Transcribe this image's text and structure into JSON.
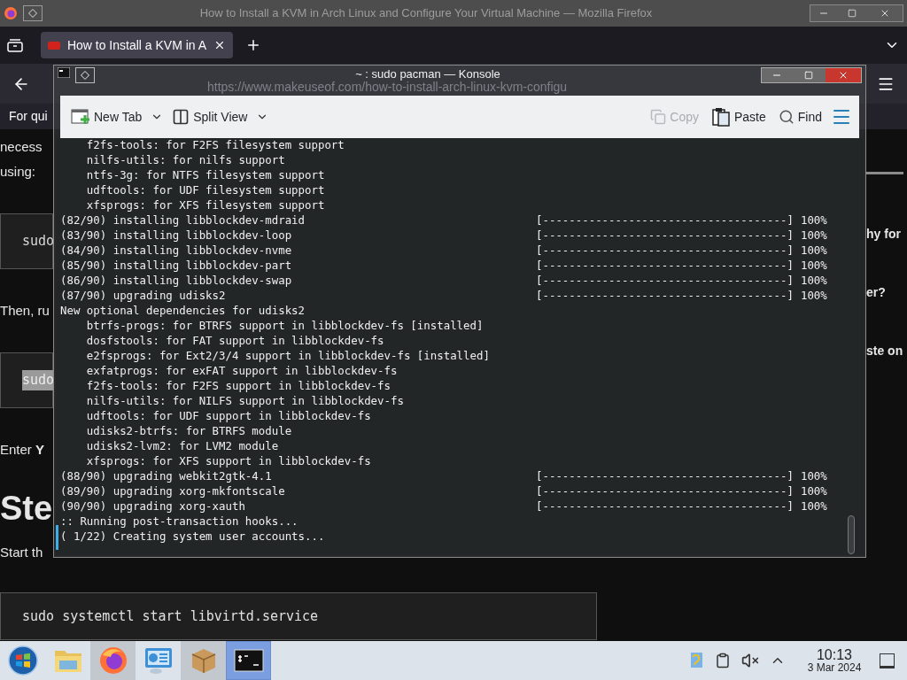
{
  "firefox": {
    "title": "How to Install a KVM in Arch Linux and Configure Your Virtual Machine — Mozilla Firefox",
    "tabs": [
      {
        "title": "How to Install a KVM in A",
        "selected": true
      }
    ],
    "url": "https://www.makeuseof.com/how-to-install-arch-linux-kvm-configu",
    "banner": "For qui",
    "article_left": [
      {
        "kind": "text",
        "text": "necess"
      },
      {
        "kind": "text",
        "text": "using:"
      },
      {
        "kind": "code",
        "text": "sudo",
        "selected": false
      },
      {
        "kind": "text",
        "text": "Then, ru"
      },
      {
        "kind": "code",
        "text": "sudo",
        "selected": true
      },
      {
        "kind": "text",
        "text": "Enter **Y**"
      },
      {
        "kind": "heading",
        "text": "Ste"
      },
      {
        "kind": "text",
        "text": "Start th"
      }
    ],
    "article_right": [
      {
        "kind": "rule"
      },
      {
        "kind": "text",
        "text": "hy for"
      },
      {
        "kind": "text",
        "text": "er?"
      },
      {
        "kind": "text",
        "text": "ste on"
      }
    ],
    "code_block": "sudo systemctl start libvirtd.service"
  },
  "konsole": {
    "title": "~ : sudo pacman — Konsole",
    "toolbar": [
      {
        "kind": "new-tab",
        "label": "New Tab",
        "disabled": false
      },
      {
        "kind": "split-view",
        "label": "Split View",
        "disabled": false
      },
      {
        "kind": "copy",
        "label": "Copy",
        "disabled": true
      },
      {
        "kind": "paste",
        "label": "Paste",
        "disabled": false
      },
      {
        "kind": "find",
        "label": "Find",
        "disabled": false
      }
    ],
    "lines": [
      {
        "kind": "text",
        "text": "    f2fs-tools: for F2FS filesystem support"
      },
      {
        "kind": "text",
        "text": "    nilfs-utils: for nilfs support"
      },
      {
        "kind": "text",
        "text": "    ntfs-3g: for NTFS filesystem support"
      },
      {
        "kind": "text",
        "text": "    udftools: for UDF filesystem support"
      },
      {
        "kind": "text",
        "text": "    xfsprogs: for XFS filesystem support"
      },
      {
        "kind": "progress",
        "text": "(82/90) installing libblockdev-mdraid",
        "bar": "[-------------------------------------]",
        "percent": "100%"
      },
      {
        "kind": "progress",
        "text": "(83/90) installing libblockdev-loop",
        "bar": "[-------------------------------------]",
        "percent": "100%"
      },
      {
        "kind": "progress",
        "text": "(84/90) installing libblockdev-nvme",
        "bar": "[-------------------------------------]",
        "percent": "100%"
      },
      {
        "kind": "progress",
        "text": "(85/90) installing libblockdev-part",
        "bar": "[-------------------------------------]",
        "percent": "100%"
      },
      {
        "kind": "progress",
        "text": "(86/90) installing libblockdev-swap",
        "bar": "[-------------------------------------]",
        "percent": "100%"
      },
      {
        "kind": "progress",
        "text": "(87/90) upgrading udisks2",
        "bar": "[-------------------------------------]",
        "percent": "100%"
      },
      {
        "kind": "text",
        "text": "New optional dependencies for udisks2"
      },
      {
        "kind": "text",
        "text": "    btrfs-progs: for BTRFS support in libblockdev-fs [installed]"
      },
      {
        "kind": "text",
        "text": "    dosfstools: for FAT support in libblockdev-fs"
      },
      {
        "kind": "text",
        "text": "    e2fsprogs: for Ext2/3/4 support in libblockdev-fs [installed]"
      },
      {
        "kind": "text",
        "text": "    exfatprogs: for exFAT support in libblockdev-fs"
      },
      {
        "kind": "text",
        "text": "    f2fs-tools: for F2FS support in libblockdev-fs"
      },
      {
        "kind": "text",
        "text": "    nilfs-utils: for NILFS support in libblockdev-fs"
      },
      {
        "kind": "text",
        "text": "    udftools: for UDF support in libblockdev-fs"
      },
      {
        "kind": "text",
        "text": "    udisks2-btrfs: for BTRFS module"
      },
      {
        "kind": "text",
        "text": "    udisks2-lvm2: for LVM2 module"
      },
      {
        "kind": "text",
        "text": "    xfsprogs: for XFS support in libblockdev-fs"
      },
      {
        "kind": "progress",
        "text": "(88/90) upgrading webkit2gtk-4.1",
        "bar": "[-------------------------------------]",
        "percent": "100%"
      },
      {
        "kind": "progress",
        "text": "(89/90) upgrading xorg-mkfontscale",
        "bar": "[-------------------------------------]",
        "percent": "100%"
      },
      {
        "kind": "progress",
        "text": "(90/90) upgrading xorg-xauth",
        "bar": "[-------------------------------------]",
        "percent": "100%"
      },
      {
        "kind": "text",
        "text": ":: Running post-transaction hooks..."
      },
      {
        "kind": "cursor",
        "text": "( 1/22) Creating system user accounts..."
      }
    ]
  },
  "taskbar": {
    "apps": [
      {
        "kind": "start",
        "open": false,
        "focused": false
      },
      {
        "kind": "folder",
        "open": false,
        "focused": false
      },
      {
        "kind": "firefox",
        "open": true,
        "focused": false
      },
      {
        "kind": "settings",
        "open": false,
        "focused": false
      },
      {
        "kind": "package",
        "open": true,
        "focused": false
      },
      {
        "kind": "terminal",
        "open": true,
        "focused": true
      }
    ],
    "tray": [
      {
        "kind": "updates"
      },
      {
        "kind": "clipboard"
      },
      {
        "kind": "muted"
      },
      {
        "kind": "expand"
      }
    ],
    "clock": {
      "time": "10:13",
      "date": "3 Mar 2024"
    }
  }
}
